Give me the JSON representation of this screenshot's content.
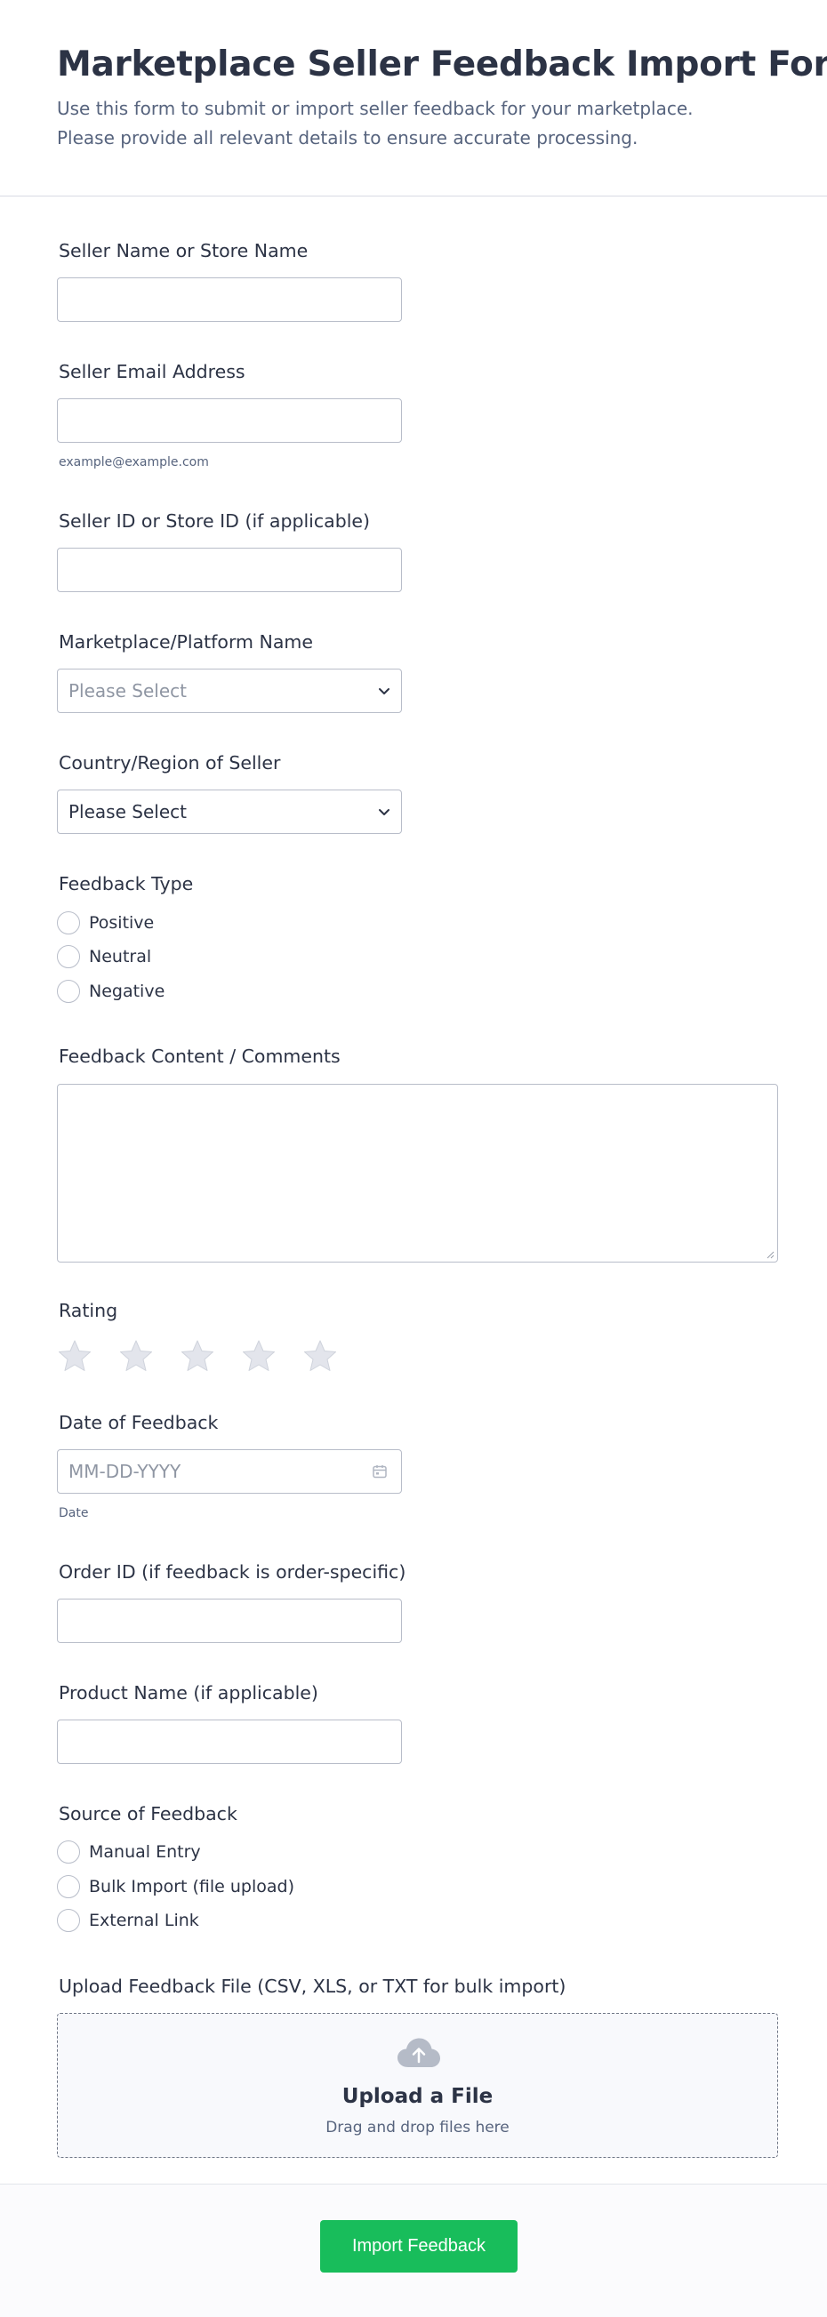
{
  "form": {
    "title": "Marketplace Seller Feedback Import Form",
    "subtitle": "Use this form to submit or import seller feedback for your marketplace. Please provide all relevant details to ensure accurate processing."
  },
  "fields": {
    "seller_name": {
      "label": "Seller Name or Store Name",
      "value": ""
    },
    "seller_email": {
      "label": "Seller Email Address",
      "value": "",
      "sublabel": "example@example.com"
    },
    "seller_id": {
      "label": "Seller ID or Store ID (if applicable)",
      "value": ""
    },
    "marketplace": {
      "label": "Marketplace/Platform Name",
      "placeholder": "Please Select"
    },
    "country": {
      "label": "Country/Region of Seller",
      "value": "Please Select"
    },
    "feedback_type": {
      "label": "Feedback Type",
      "options": [
        "Positive",
        "Neutral",
        "Negative"
      ]
    },
    "feedback_content": {
      "label": "Feedback Content / Comments",
      "value": ""
    },
    "rating": {
      "label": "Rating",
      "max": 5,
      "value": 0
    },
    "feedback_date": {
      "label": "Date of Feedback",
      "placeholder": "MM-DD-YYYY",
      "sublabel": "Date"
    },
    "order_id": {
      "label": "Order ID (if feedback is order-specific)",
      "value": ""
    },
    "product_name": {
      "label": "Product Name (if applicable)",
      "value": ""
    },
    "source": {
      "label": "Source of Feedback",
      "options": [
        "Manual Entry",
        "Bulk Import (file upload)",
        "External Link"
      ]
    },
    "upload": {
      "label": "Upload Feedback File (CSV, XLS, or TXT for bulk import)",
      "title": "Upload a File",
      "hint": "Drag and drop files here"
    }
  },
  "submit": {
    "label": "Import Feedback"
  },
  "icons": {
    "select": "chevron-down-icon",
    "date": "calendar-icon",
    "rating": "star-icon",
    "upload": "cloud-upload-icon"
  },
  "colors": {
    "accent": "#18bd5b",
    "text": "#2c3345",
    "muted": "#57647e",
    "border": "#b8bdc9",
    "star_empty": "#e3e5ec"
  }
}
